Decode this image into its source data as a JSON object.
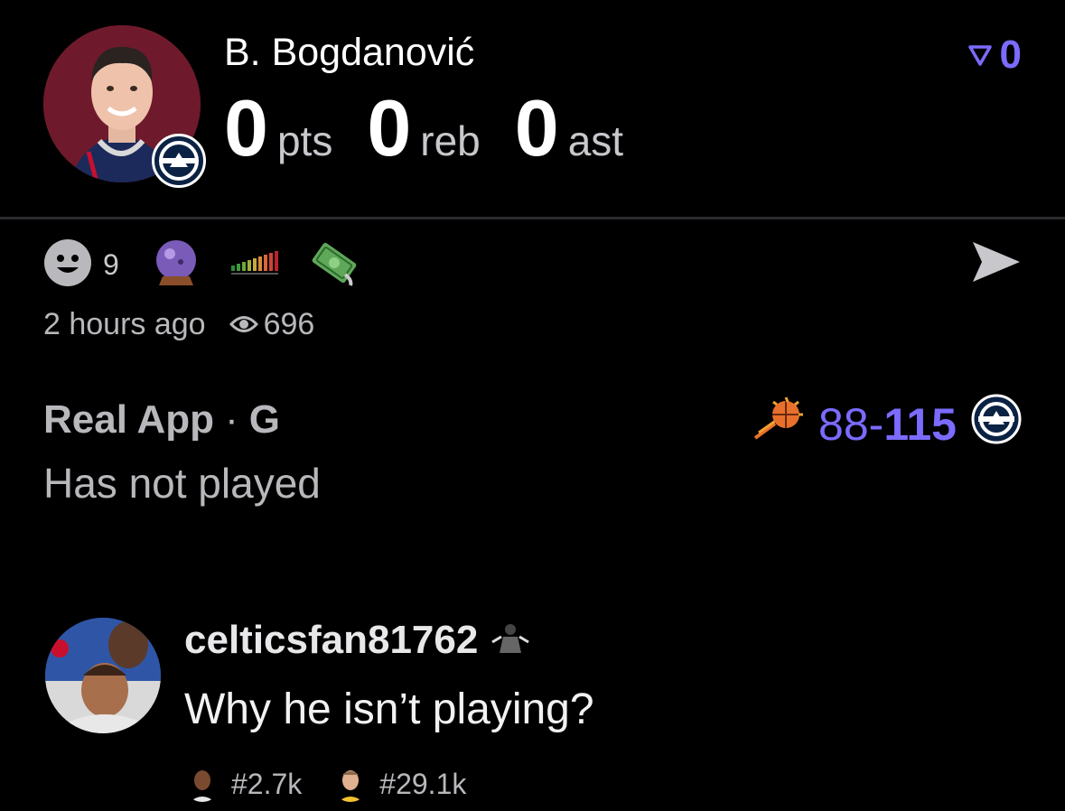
{
  "player": {
    "name": "B. Bogdanović",
    "stats": [
      {
        "value": "0",
        "unit": "pts"
      },
      {
        "value": "0",
        "unit": "reb"
      },
      {
        "value": "0",
        "unit": "ast"
      }
    ]
  },
  "votes": {
    "count": "0",
    "icon": "upvote-arrow-icon"
  },
  "reactions": {
    "emoji_count": "9"
  },
  "meta": {
    "time": "2 hours ago",
    "views": "696"
  },
  "source": {
    "app": "Real App",
    "separator": "·",
    "position": "G",
    "status": "Has not played"
  },
  "game": {
    "opponent_score": "88",
    "dash": "-",
    "team_score": "115"
  },
  "comment": {
    "username": "celticsfan81762",
    "text": "Why he isn’t playing?",
    "ranks": [
      "#2.7k",
      "#29.1k"
    ]
  },
  "colors": {
    "accent": "#7b6bff",
    "muted": "#b8b8bc",
    "background": "#000000",
    "divider": "#2a2a2e"
  }
}
